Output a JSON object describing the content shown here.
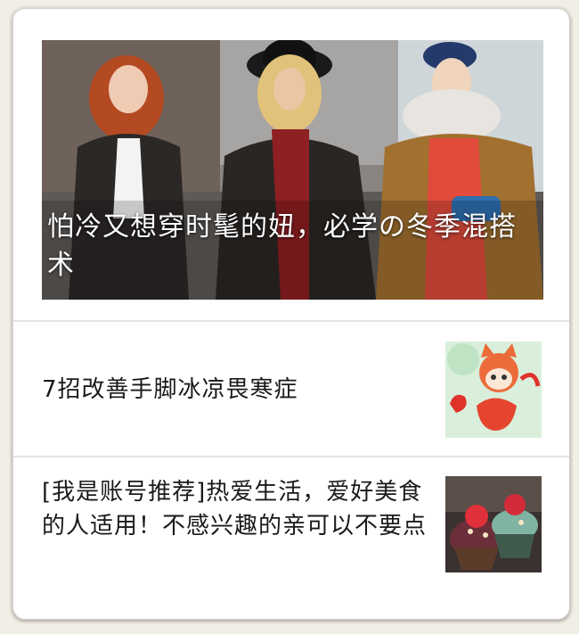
{
  "feed": {
    "hero": {
      "title": "怕冷又想穿时髦的妞，必学の冬季混搭术",
      "image": "winter-street-fashion-photo"
    },
    "items": [
      {
        "title": "7招改善手脚冰凉畏寒症",
        "thumbnail": "cartoon-fox-girl-thumbnail"
      },
      {
        "title": "[我是账号推荐]热爱生活，爱好美食的人适用！不感兴趣的亲可以不要点",
        "thumbnail": "cupcakes-thumbnail"
      }
    ]
  }
}
